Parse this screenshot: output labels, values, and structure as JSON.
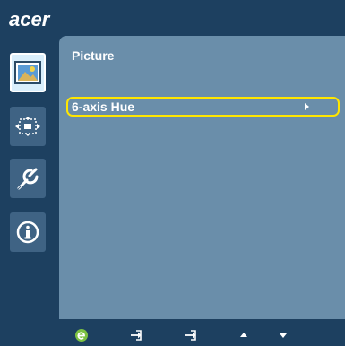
{
  "brand": {
    "logo_text": "acer"
  },
  "sidebar": {
    "items": [
      {
        "icon": "picture-icon",
        "active": true
      },
      {
        "icon": "screen-position-icon",
        "active": false
      },
      {
        "icon": "settings-wrench-icon",
        "active": false
      },
      {
        "icon": "info-icon",
        "active": false
      }
    ]
  },
  "panel": {
    "title": "Picture",
    "selected_item": {
      "label": "6-axis Hue",
      "icon": "arrow-right-icon"
    }
  },
  "footer": {
    "keys": [
      {
        "icon": "empowering-e-icon"
      },
      {
        "icon": "enter-icon"
      },
      {
        "icon": "enter-icon"
      },
      {
        "icon": "arrow-up-icon"
      },
      {
        "icon": "arrow-down-icon"
      }
    ]
  },
  "colors": {
    "background": "#1d4060",
    "panel": "#6a8eaa",
    "sidebar_button": "#3f6384",
    "selection_border": "#ffe600",
    "text": "#ffffff",
    "e_icon": "#7cc242"
  }
}
